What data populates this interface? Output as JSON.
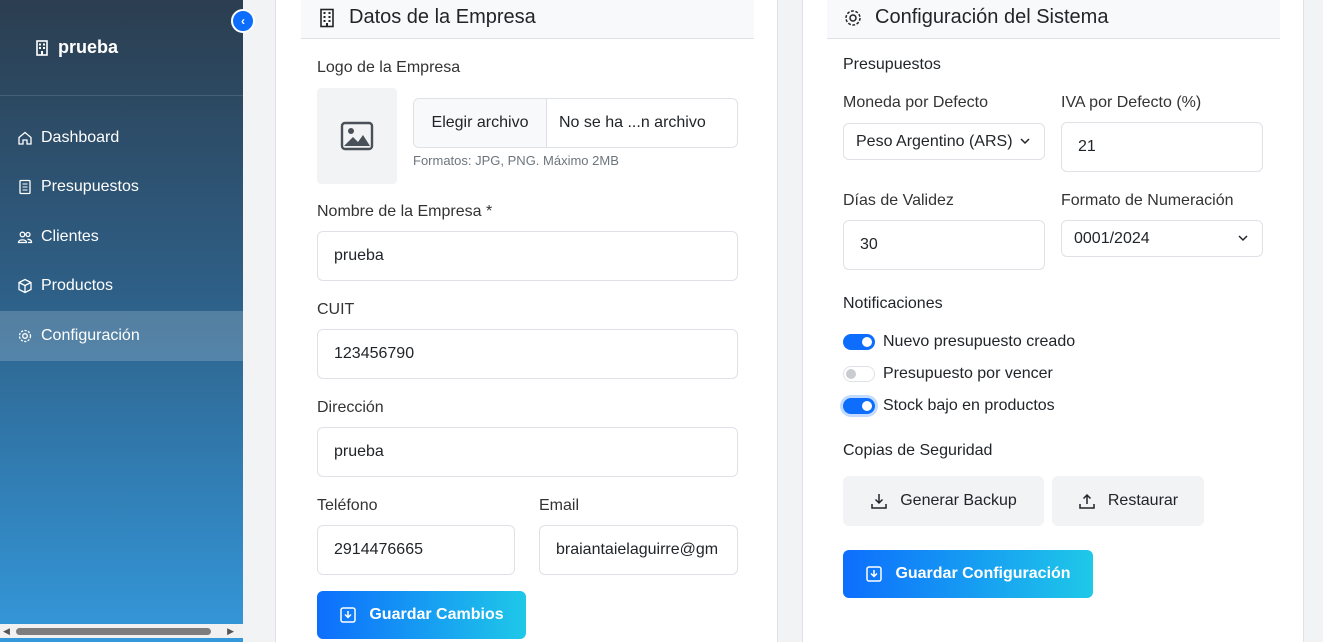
{
  "sidebar": {
    "brand": "prueba",
    "items": [
      {
        "label": "Dashboard"
      },
      {
        "label": "Presupuestos"
      },
      {
        "label": "Clientes"
      },
      {
        "label": "Productos"
      },
      {
        "label": "Configuración"
      }
    ]
  },
  "company": {
    "title": "Datos de la Empresa",
    "logo_label": "Logo de la Empresa",
    "file_button": "Elegir archivo",
    "file_status": "No se ha ...n archivo",
    "file_help": "Formatos: JPG, PNG. Máximo 2MB",
    "name_label": "Nombre de la Empresa *",
    "name_value": "prueba",
    "cuit_label": "CUIT",
    "cuit_value": "123456790",
    "address_label": "Dirección",
    "address_value": "prueba",
    "phone_label": "Teléfono",
    "phone_value": "2914476665",
    "email_label": "Email",
    "email_value": "braiantaielaguirre@gm",
    "save_button": "Guardar Cambios"
  },
  "system": {
    "title": "Configuración del Sistema",
    "budgets_section": "Presupuestos",
    "currency_label": "Moneda por Defecto",
    "currency_value": "Peso Argentino (ARS)",
    "iva_label": "IVA por Defecto (%)",
    "iva_value": "21",
    "validity_label": "Días de Validez",
    "validity_value": "30",
    "numbering_label": "Formato de Numeración",
    "numbering_value": "0001/2024",
    "notifications_section": "Notificaciones",
    "notifications": [
      {
        "label": "Nuevo presupuesto creado",
        "on": true
      },
      {
        "label": "Presupuesto por vencer",
        "on": false
      },
      {
        "label": "Stock bajo en productos",
        "on": true
      }
    ],
    "backup_section": "Copias de Seguridad",
    "backup_button": "Generar Backup",
    "restore_button": "Restaurar",
    "save_button": "Guardar Configuración"
  },
  "colors": {
    "primary": "#0d6efd",
    "accent": "#1fc8e8",
    "sidebar_top": "#2c3e50",
    "sidebar_bottom": "#3498db"
  }
}
